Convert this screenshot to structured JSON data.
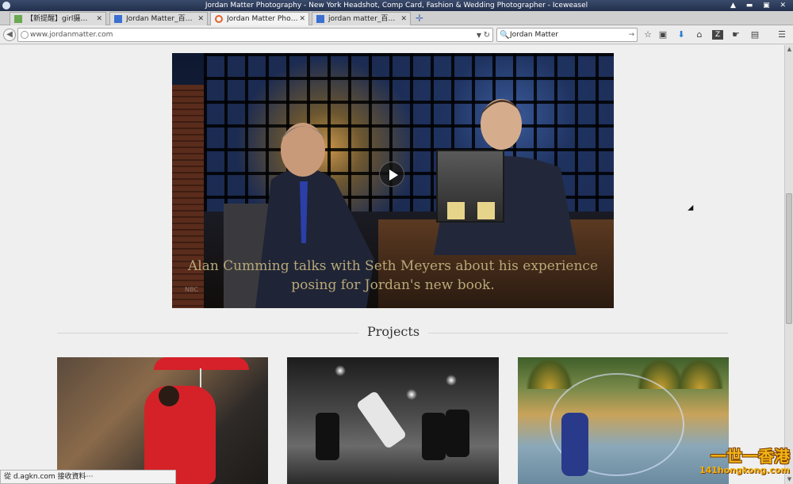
{
  "window": {
    "title": "Jordan Matter Photography - New York Headshot, Comp Card, Fashion & Wedding Photographer - Iceweasel",
    "controls": "▲ ▬ ▣ ✕"
  },
  "tabs": [
    {
      "label": "【新提醒】girl摄…",
      "favicon": "forum-icon",
      "close": "✕"
    },
    {
      "label": "Jordan Matter_百…",
      "favicon": "baidu-icon",
      "close": "✕"
    },
    {
      "label": "Jordan Matter Pho…",
      "favicon": "loading-icon",
      "close": "✕",
      "active": true
    },
    {
      "label": "jordan matter_百…",
      "favicon": "baidu-icon",
      "close": "✕"
    }
  ],
  "newtab_label": "✛",
  "navbar": {
    "back": "◀",
    "url": "www.jordanmatter.com",
    "url_dropdown": "▼",
    "reload": "↻",
    "search_icon": "🔍",
    "search_query": "Jordan Matter",
    "search_go": "→",
    "icons": [
      "star-icon",
      "clipboard-icon",
      "download-icon",
      "home-icon",
      "zotero-icon",
      "hand-icon",
      "clipboard-menu-icon",
      "menu-icon"
    ],
    "icon_glyphs": [
      "☆",
      "▣",
      "⬇",
      "⌂",
      "Z",
      "☛",
      "▤",
      "☰"
    ]
  },
  "video": {
    "caption_line1": "Alan Cumming talks with Seth Meyers about his experience",
    "caption_line2": "posing for Jordan's new book.",
    "logo": "NBC"
  },
  "projects": {
    "title": "Projects"
  },
  "status": "從 d.agkn.com 接收資料⋯",
  "watermark": {
    "line1": "一世一香港",
    "line2": "141hongkong.com"
  },
  "scrollbar": {
    "up": "▲",
    "down": "▼"
  },
  "colors": {
    "accent_red": "#d42228",
    "caption_gold": "#b8a878",
    "watermark_gold": "#f2b414"
  }
}
